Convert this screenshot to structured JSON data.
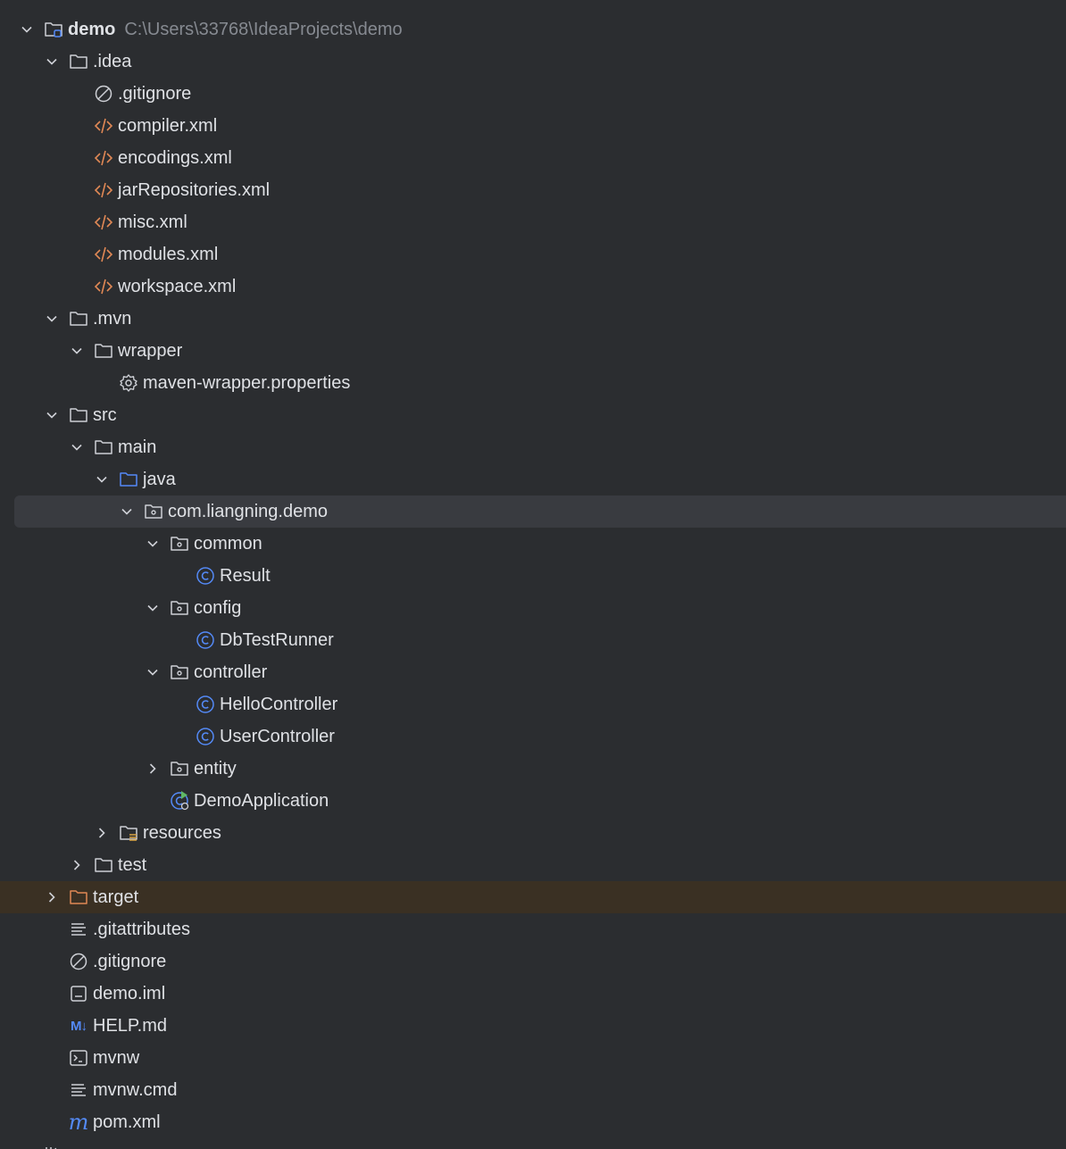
{
  "project": {
    "name": "demo",
    "path": "C:\\Users\\33768\\IdeaProjects\\demo"
  },
  "tree": [
    {
      "label": ".idea"
    },
    {
      "label": ".gitignore"
    },
    {
      "label": "compiler.xml"
    },
    {
      "label": "encodings.xml"
    },
    {
      "label": "jarRepositories.xml"
    },
    {
      "label": "misc.xml"
    },
    {
      "label": "modules.xml"
    },
    {
      "label": "workspace.xml"
    },
    {
      "label": ".mvn"
    },
    {
      "label": "wrapper"
    },
    {
      "label": "maven-wrapper.properties"
    },
    {
      "label": "src"
    },
    {
      "label": "main"
    },
    {
      "label": "java"
    },
    {
      "label": "com.liangning.demo"
    },
    {
      "label": "common"
    },
    {
      "label": "Result"
    },
    {
      "label": "config"
    },
    {
      "label": "DbTestRunner"
    },
    {
      "label": "controller"
    },
    {
      "label": "HelloController"
    },
    {
      "label": "UserController"
    },
    {
      "label": "entity"
    },
    {
      "label": "DemoApplication"
    },
    {
      "label": "resources"
    },
    {
      "label": "test"
    },
    {
      "label": "target"
    },
    {
      "label": ".gitattributes"
    },
    {
      "label": ".gitignore"
    },
    {
      "label": "demo.iml"
    },
    {
      "label": "HELP.md"
    },
    {
      "label": "mvnw"
    },
    {
      "label": "mvnw.cmd"
    },
    {
      "label": "pom.xml"
    }
  ],
  "icon_glyphs": {
    "markdown": "M↓",
    "maven": "m"
  },
  "colors": {
    "background": "#2b2d30",
    "selected_row": "#393b40",
    "excluded_row": "#3a3023",
    "text": "#dfe1e5",
    "path_text": "#868a91",
    "folder_icon": "#ced0d6",
    "source_folder": "#548af7",
    "excluded_folder": "#e08855",
    "xml_icon": "#e08855",
    "class_icon": "#548af7",
    "run_badge": "#5fb865"
  }
}
